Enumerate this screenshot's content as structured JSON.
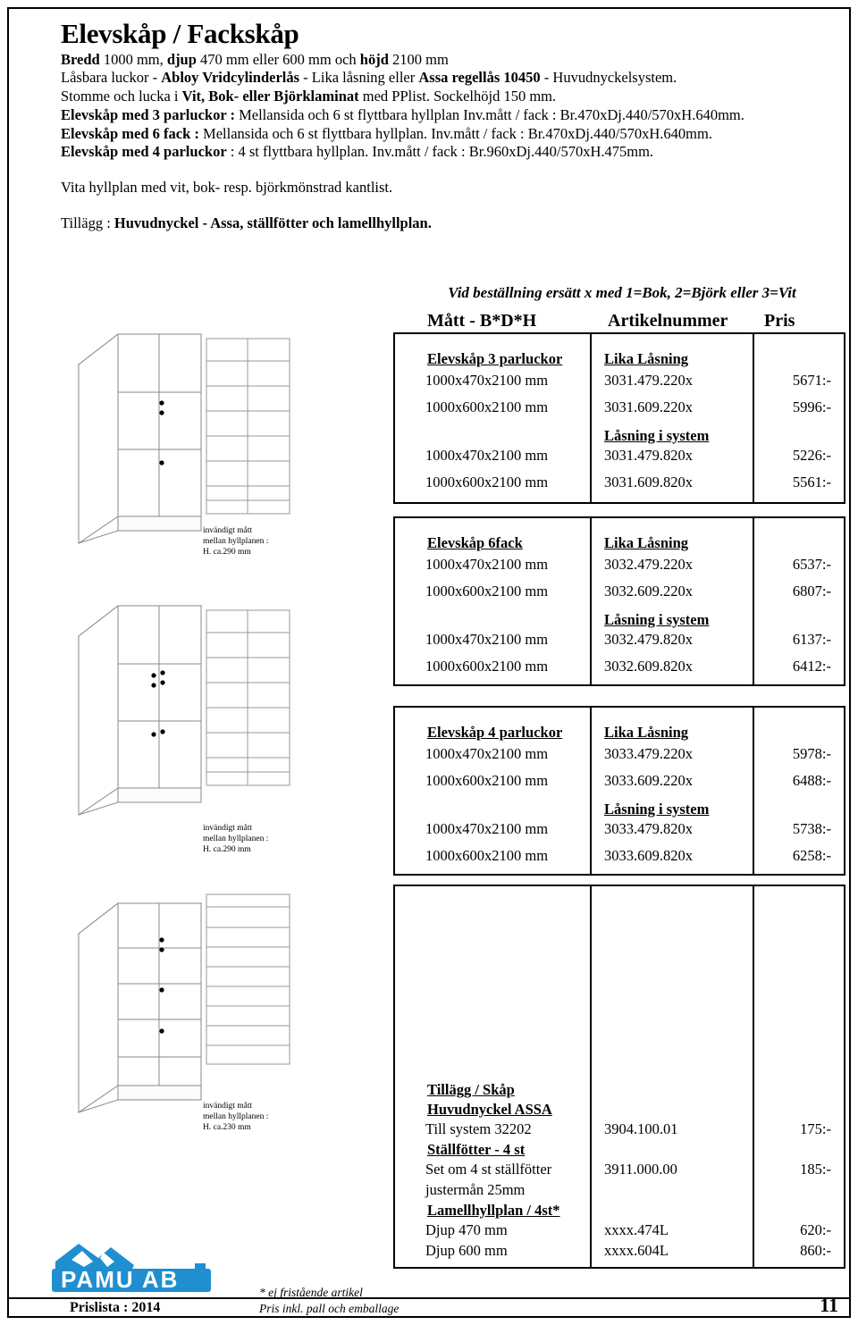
{
  "document": {
    "title": "Elevskåp / Fackskåp",
    "spec_lines": [
      [
        {
          "t": "Bredd",
          "b": true
        },
        {
          "t": " 1000 mm, ",
          "b": false
        },
        {
          "t": "djup",
          "b": true
        },
        {
          "t": " 470 mm eller 600 mm och ",
          "b": false
        },
        {
          "t": "höjd",
          "b": true
        },
        {
          "t": " 2100 mm",
          "b": false
        }
      ],
      [
        {
          "t": "Låsbara luckor - ",
          "b": false
        },
        {
          "t": "Abloy Vridcylinderlås",
          "b": true
        },
        {
          "t": " - Lika låsning eller ",
          "b": false
        },
        {
          "t": "Assa regellås 10450",
          "b": true
        },
        {
          "t": " - Huvudnyckelsystem.",
          "b": false
        }
      ],
      [
        {
          "t": "Stomme och lucka i ",
          "b": false
        },
        {
          "t": "Vit, Bok- eller Björklaminat",
          "b": true
        },
        {
          "t": " med PPlist. Sockelhöjd 150 mm.",
          "b": false
        }
      ],
      [
        {
          "t": "Elevskåp med 3 parluckor :",
          "b": true
        },
        {
          "t": " Mellansida och 6 st flyttbara hyllplan Inv.mått / fack : Br.470xDj.440/570xH.640mm.",
          "b": false
        }
      ],
      [
        {
          "t": "Elevskåp med 6 fack :",
          "b": true
        },
        {
          "t": " Mellansida och 6 st flyttbara hyllplan. Inv.mått / fack : Br.470xDj.440/570xH.640mm.",
          "b": false
        }
      ],
      [
        {
          "t": "Elevskåp med 4 parluckor",
          "b": true
        },
        {
          "t": " : 4 st flyttbara hyllplan. Inv.mått / fack : Br.960xDj.440/570xH.475mm.",
          "b": false
        }
      ]
    ],
    "note_shelves": "Vita hyllplan med vit, bok- resp. björkmönstrad kantlist.",
    "note_extra_prefix": "Tillägg : ",
    "note_extra_bold": "Huvudnyckel - Assa, ställfötter och lamellhyllplan."
  },
  "table": {
    "order_note": "Vid beställning ersätt x med 1=Bok, 2=Björk eller 3=Vit",
    "columns": {
      "matt": "Mått - B*D*H",
      "artikelnummer": "Artikelnummer",
      "pris": "Pris"
    },
    "sections": [
      {
        "id": "elevskap-3-parluckor",
        "product_heading": "Elevskåp 3 parluckor",
        "lock_heading_1": "Lika Låsning",
        "lock_heading_2": "Låsning i system",
        "rows": [
          {
            "matt": "1000x470x2100 mm",
            "art": "3031.479.220x",
            "pris": "5671:-"
          },
          {
            "matt": "1000x600x2100 mm",
            "art": "3031.609.220x",
            "pris": "5996:-"
          },
          {
            "matt": "1000x470x2100 mm",
            "art": "3031.479.820x",
            "pris": "5226:-"
          },
          {
            "matt": "1000x600x2100 mm",
            "art": "3031.609.820x",
            "pris": "5561:-"
          }
        ]
      },
      {
        "id": "elevskap-6fack",
        "product_heading": "Elevskåp   6fack",
        "lock_heading_1": "Lika Låsning",
        "lock_heading_2": "Låsning i system",
        "rows": [
          {
            "matt": "1000x470x2100 mm",
            "art": "3032.479.220x",
            "pris": "6537:-"
          },
          {
            "matt": "1000x600x2100 mm",
            "art": "3032.609.220x",
            "pris": "6807:-"
          },
          {
            "matt": "1000x470x2100 mm",
            "art": "3032.479.820x",
            "pris": "6137:-"
          },
          {
            "matt": "1000x600x2100 mm",
            "art": "3032.609.820x",
            "pris": "6412:-"
          }
        ]
      },
      {
        "id": "elevskap-4-parluckor",
        "product_heading": "Elevskåp 4 parluckor",
        "lock_heading_1": "Lika Låsning",
        "lock_heading_2": "Låsning i system",
        "rows": [
          {
            "matt": "1000x470x2100 mm",
            "art": "3033.479.220x",
            "pris": "5978:-"
          },
          {
            "matt": "1000x600x2100 mm",
            "art": "3033.609.220x",
            "pris": "6488:-"
          },
          {
            "matt": "1000x470x2100 mm",
            "art": "3033.479.820x",
            "pris": "5738:-"
          },
          {
            "matt": "1000x600x2100 mm",
            "art": "3033.609.820x",
            "pris": "6258:-"
          }
        ]
      }
    ],
    "addons": {
      "title": "Tillägg / Skåp",
      "groups": [
        {
          "heading": "Huvudnyckel ASSA",
          "rows": [
            {
              "matt": "Till system 32202",
              "art": "3904.100.01",
              "pris": "175:-"
            }
          ]
        },
        {
          "heading": "Ställfötter - 4 st",
          "rows": [
            {
              "matt": "Set om 4 st ställfötter",
              "art": "3911.000.00",
              "pris": "185:-"
            },
            {
              "matt": "justermån 25mm",
              "art": "",
              "pris": ""
            }
          ]
        },
        {
          "heading": "Lamellhyllplan / 4st*",
          "rows": [
            {
              "matt": "Djup 470 mm",
              "art": "xxxx.474L",
              "pris": "620:-"
            },
            {
              "matt": "Djup 600 mm",
              "art": "xxxx.604L",
              "pris": "860:-"
            }
          ]
        }
      ]
    }
  },
  "drawings": [
    {
      "id": "cabinet-3-parluckor",
      "dim_note": "invändigt mått\nmellan hyllplanen :\nH. ca.290 mm"
    },
    {
      "id": "cabinet-6fack",
      "dim_note": "invändigt mått\nmellan hyllplanen :\nH. ca.290 mm"
    },
    {
      "id": "cabinet-4-parluckor",
      "dim_note": "invändigt mått\nmellan hyllplanen :\nH. ca.230 mm"
    }
  ],
  "footer": {
    "logo_text": "PAMU AB",
    "prislista": "Prislista : 2014",
    "note_1": "* ej fristående artikel",
    "note_2": "Pris inkl. pall och emballage",
    "page_number": "11"
  },
  "colors": {
    "logo_blue": "#1f8fd0",
    "ink": "#000000",
    "line": "#9a9a9a"
  }
}
